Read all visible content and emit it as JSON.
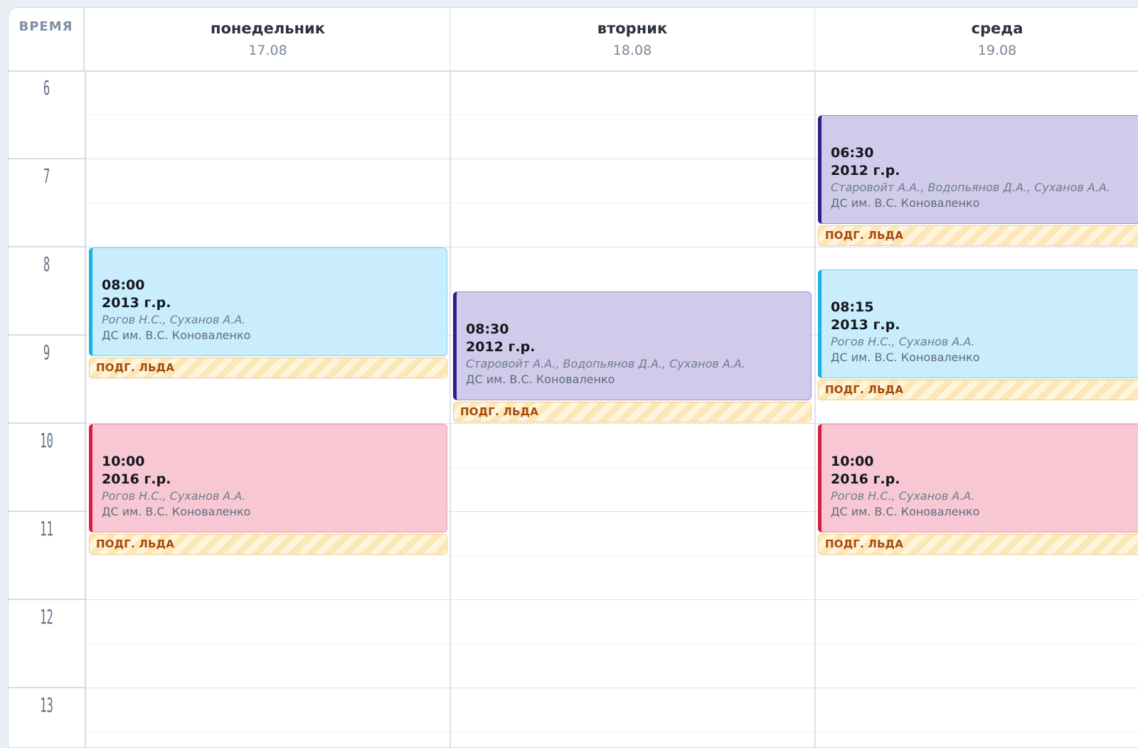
{
  "time_header": "ВРЕМЯ",
  "days": [
    {
      "name": "понедельник",
      "date": "17.08"
    },
    {
      "name": "вторник",
      "date": "18.08"
    },
    {
      "name": "среда",
      "date": "19.08"
    }
  ],
  "hours": [
    "6",
    "7",
    "8",
    "9",
    "10",
    "11",
    "12",
    "13"
  ],
  "events": [
    {
      "day": 0,
      "start": "08:00",
      "end": "09:30",
      "time": "08:00",
      "group": "2013 г.р.",
      "coaches": "Рогов Н.С., Суханов А.А.",
      "place": "ДС им. В.С. Коноваленко",
      "color": "blue",
      "ice": "ПОДГ. ЛЬДА"
    },
    {
      "day": 0,
      "start": "10:00",
      "end": "11:30",
      "time": "10:00",
      "group": "2016 г.р.",
      "coaches": "Рогов Н.С., Суханов А.А.",
      "place": "ДС им. В.С. Коноваленко",
      "color": "pink",
      "ice": "ПОДГ. ЛЬДА"
    },
    {
      "day": 1,
      "start": "08:30",
      "end": "10:00",
      "time": "08:30",
      "group": "2012 г.р.",
      "coaches": "Старовойт А.А., Водопьянов Д.А., Суханов А.А.",
      "place": "ДС им. В.С. Коноваленко",
      "color": "purple",
      "ice": "ПОДГ. ЛЬДА"
    },
    {
      "day": 2,
      "start": "06:30",
      "end": "08:00",
      "time": "06:30",
      "group": "2012 г.р.",
      "coaches": "Старовойт А.А., Водопьянов Д.А., Суханов А.А.",
      "place": "ДС им. В.С. Коноваленко",
      "color": "purple",
      "ice": "ПОДГ. ЛЬДА"
    },
    {
      "day": 2,
      "start": "08:15",
      "end": "09:45",
      "time": "08:15",
      "group": "2013 г.р.",
      "coaches": "Рогов Н.С., Суханов А.А.",
      "place": "ДС им. В.С. Коноваленко",
      "color": "blue",
      "ice": "ПОДГ. ЛЬДА"
    },
    {
      "day": 2,
      "start": "10:00",
      "end": "11:30",
      "time": "10:00",
      "group": "2016 г.р.",
      "coaches": "Рогов Н.С., Суханов А.А.",
      "place": "ДС им. В.С. Коноваленко",
      "color": "pink",
      "ice": "ПОДГ. ЛЬДА"
    }
  ],
  "colors": {
    "blue": "#c9edfc",
    "purple": "#d0cbea",
    "pink": "#f7c8d3",
    "ice": "#fde7b8"
  }
}
